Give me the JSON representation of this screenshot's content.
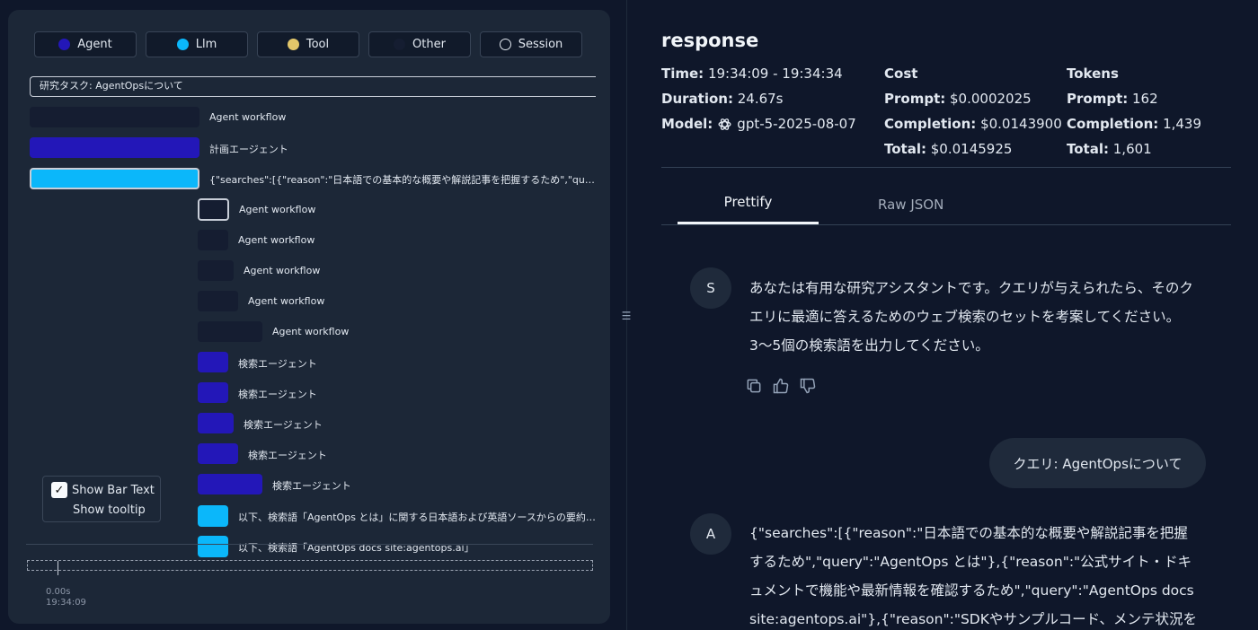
{
  "filters": [
    {
      "label": "Agent",
      "color": "#2317b8",
      "kind": "solid"
    },
    {
      "label": "Llm",
      "color": "#0bb7fa",
      "kind": "solid"
    },
    {
      "label": "Tool",
      "color": "#e3c76a",
      "kind": "solid"
    },
    {
      "label": "Other",
      "color": "#151d31",
      "kind": "solid"
    },
    {
      "label": "Session",
      "color": "#e2e8f0",
      "kind": "ring"
    }
  ],
  "trace": {
    "root_label": "研究タスク: AgentOpsについて",
    "spans": [
      {
        "label": "Agent workflow",
        "type": "other"
      },
      {
        "label": "計画エージェント",
        "type": "agent"
      },
      {
        "label": "{\"searches\":[{\"reason\":\"日本語での基本的な概要や解説記事を把握するため\",\"query\":\"AgentOps とは\"}",
        "type": "llm",
        "selected": true
      },
      {
        "label": "Agent workflow",
        "type": "other",
        "selected": true
      },
      {
        "label": "Agent workflow",
        "type": "other"
      },
      {
        "label": "Agent workflow",
        "type": "other"
      },
      {
        "label": "Agent workflow",
        "type": "other"
      },
      {
        "label": "Agent workflow",
        "type": "other"
      },
      {
        "label": "検索エージェント",
        "type": "agent"
      },
      {
        "label": "検索エージェント",
        "type": "agent"
      },
      {
        "label": "検索エージェント",
        "type": "agent"
      },
      {
        "label": "検索エージェント",
        "type": "agent"
      },
      {
        "label": "検索エージェント",
        "type": "agent"
      },
      {
        "label": "以下、検索語「AgentOps とは」に関する日本語および英語ソースからの要約です",
        "type": "llm"
      },
      {
        "label": "以下、検索語「AgentOps docs site:agentops.ai」",
        "type": "llm"
      }
    ],
    "show_bar_text_label": "Show Bar Text",
    "show_bar_text_checked": true,
    "show_tooltip_label": "Show tooltip",
    "timeline_start": "0.00s",
    "timeline_time": "19:34:09"
  },
  "detail": {
    "title": "response",
    "time_label": "Time:",
    "time_value": "19:34:09 - 19:34:34",
    "duration_label": "Duration:",
    "duration_value": "24.67s",
    "model_label": "Model:",
    "model_value": "gpt-5-2025-08-07",
    "cost_heading": "Cost",
    "cost_prompt_label": "Prompt:",
    "cost_prompt_value": "$0.0002025",
    "cost_completion_label": "Completion:",
    "cost_completion_value": "$0.0143900",
    "cost_total_label": "Total:",
    "cost_total_value": "$0.0145925",
    "tokens_heading": "Tokens",
    "tokens_prompt_label": "Prompt:",
    "tokens_prompt_value": "162",
    "tokens_completion_label": "Completion:",
    "tokens_completion_value": "1,439",
    "tokens_total_label": "Total:",
    "tokens_total_value": "1,601",
    "tabs": [
      "Prettify",
      "Raw JSON"
    ],
    "active_tab": "Prettify"
  },
  "messages": {
    "system_avatar": "S",
    "system_text": "あなたは有用な研究アシスタントです。クエリが与えられたら、そのクエリに最適に答えるためのウェブ検索のセットを考案してください。3〜5個の検索語を出力してください。",
    "user_text": "クエリ: AgentOpsについて",
    "assistant_avatar": "A",
    "assistant_text": "{\"searches\":[{\"reason\":\"日本語での基本的な概要や解説記事を把握するため\",\"query\":\"AgentOps とは\"},{\"reason\":\"公式サイト・ドキュメントで機能や最新情報を確認するため\",\"query\":\"AgentOps docs site:agentops.ai\"},{\"reason\":\"SDKやサンプルコード、メンテ状況を確"
  }
}
